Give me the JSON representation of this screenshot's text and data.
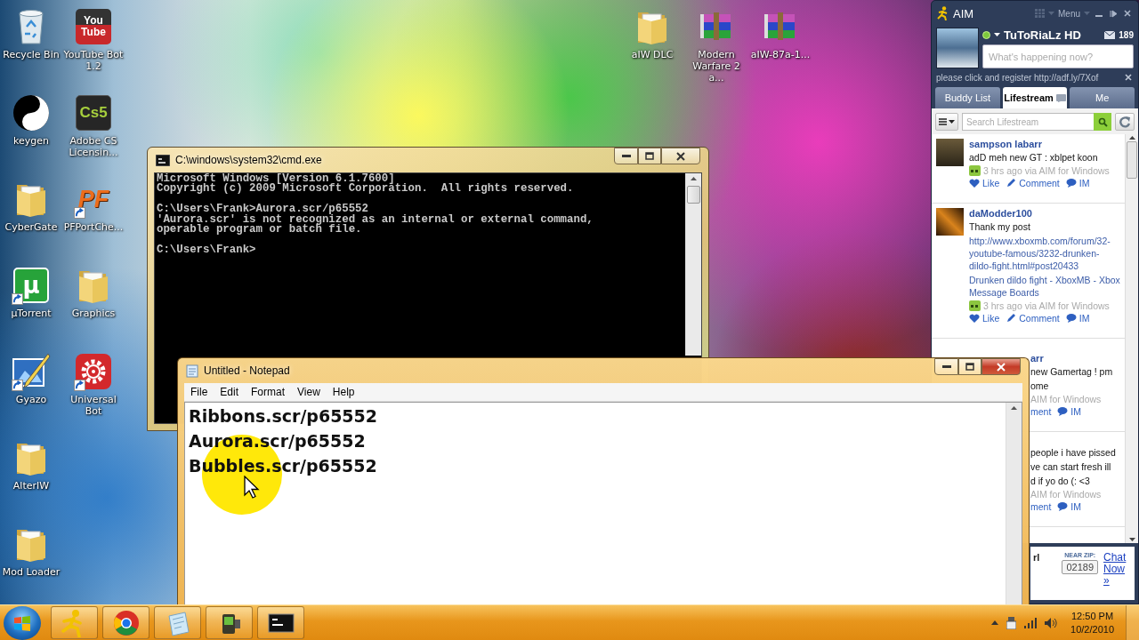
{
  "desktop_icons": [
    {
      "label": "Recycle Bin",
      "kind": "recycle"
    },
    {
      "label": "keygen",
      "kind": "yinyang"
    },
    {
      "label": "CyberGate",
      "kind": "folder"
    },
    {
      "label": "µTorrent",
      "kind": "utorrent",
      "glyph": "µ",
      "shortcut": true
    },
    {
      "label": "Gyazo",
      "kind": "gyazo",
      "shortcut": true
    },
    {
      "label": "AlterIW",
      "kind": "folder"
    },
    {
      "label": "Mod Loader",
      "kind": "folder"
    },
    {
      "label": "YouTube Bot 1.2",
      "kind": "youtube",
      "glyph": "You Tube"
    },
    {
      "label": "Adobe CS Licensin...",
      "kind": "cs5",
      "glyph": "Cs5"
    },
    {
      "label": "PFPortChe...",
      "kind": "pf",
      "glyph": "PF",
      "shortcut": true
    },
    {
      "label": "Graphics",
      "kind": "folder"
    },
    {
      "label": "Universal Bot",
      "kind": "gear",
      "shortcut": true
    }
  ],
  "top_icons": [
    {
      "label": "aIW DLC",
      "kind": "folder"
    },
    {
      "label": "Modern Warfare 2 a...",
      "kind": "archive"
    },
    {
      "label": "aIW-87a-1...",
      "kind": "archive"
    }
  ],
  "console": {
    "title": "C:\\windows\\system32\\cmd.exe",
    "output": [
      [
        "Microsoft Windows [Version 6.1.7600]",
        "Copyright (c) 2009 Microsoft Corporation.  All rights reserved."
      ],
      [
        "C:\\Users\\Frank>Aurora.scr/p65552",
        "'Aurora.scr' is not recognized as an internal or external command,",
        "operable program or batch file."
      ],
      [
        "C:\\Users\\Frank>"
      ]
    ]
  },
  "notepad": {
    "title": "Untitled - Notepad",
    "menu": [
      "File",
      "Edit",
      "Format",
      "View",
      "Help"
    ],
    "lines": [
      "Ribbons.scr/p65552",
      "Aurora.scr/p65552",
      "Bubbles.scr/p65552"
    ]
  },
  "aim": {
    "brand": "AIM",
    "menu_label": "Menu",
    "username": "TuToRiaLz HD",
    "mail_count": "189",
    "status_placeholder": "What's happening now?",
    "notice": "please click and register http://adf.ly/7Xof",
    "tabs": [
      {
        "label": "Buddy List",
        "selected": false
      },
      {
        "label": "Lifestream",
        "selected": true
      },
      {
        "label": "Me",
        "selected": false
      }
    ],
    "search_placeholder": "Search Lifestream",
    "posts": [
      {
        "kind": "full",
        "author": "sampson labarr",
        "body": [
          {
            "text": "adD meh new GT : xblpet koon",
            "link": false
          }
        ],
        "meta": "3 hrs ago via AIM for Windows",
        "actions": [
          {
            "label": "Like",
            "kind": "like"
          },
          {
            "label": "Comment",
            "kind": "comment"
          },
          {
            "label": "IM",
            "kind": "im"
          }
        ]
      },
      {
        "kind": "full",
        "author": "daModder100",
        "body": [
          {
            "text": "Thank my post",
            "link": false
          },
          {
            "text": "http://www.xboxmb.com/forum/32-youtube-famous/3232-drunken-dildo-fight.html#post20433",
            "link": true
          },
          {
            "text": "Drunken dildo fight - XboxMB - Xbox Message Boards",
            "link": true
          }
        ],
        "meta": "3 hrs ago via AIM for Windows",
        "actions": [
          {
            "label": "Like",
            "kind": "like"
          },
          {
            "label": "Comment",
            "kind": "comment"
          },
          {
            "label": "IM",
            "kind": "im"
          }
        ]
      },
      {
        "kind": "clipped",
        "author": "arr",
        "body": [
          {
            "text": "new Gamertag ! pm",
            "link": false
          },
          {
            "text": "ome",
            "link": false
          }
        ],
        "meta": "AIM for Windows",
        "actions": [
          {
            "label": "ment",
            "kind": "cut"
          },
          {
            "label": "IM",
            "kind": "im"
          }
        ]
      },
      {
        "kind": "clipped",
        "body": [
          {
            "text": "people i have pissed",
            "link": false
          },
          {
            "text": "ve can start fresh ill",
            "link": false
          },
          {
            "text": "d if yo do (: <3",
            "link": false
          }
        ],
        "meta": "AIM for Windows",
        "actions": [
          {
            "label": "ment",
            "kind": "cut"
          },
          {
            "label": "IM",
            "kind": "im"
          }
        ]
      }
    ],
    "ad": {
      "fragment": "rl",
      "zip_label": "NEAR ZIP:",
      "zip": "02189",
      "link": "Chat Now »"
    }
  },
  "taskbar": {
    "apps": [
      {
        "kind": "aim"
      },
      {
        "kind": "chrome"
      },
      {
        "kind": "notepad"
      },
      {
        "kind": "camera"
      },
      {
        "kind": "console"
      }
    ],
    "time": "12:50 PM",
    "date": "10/2/2010"
  }
}
